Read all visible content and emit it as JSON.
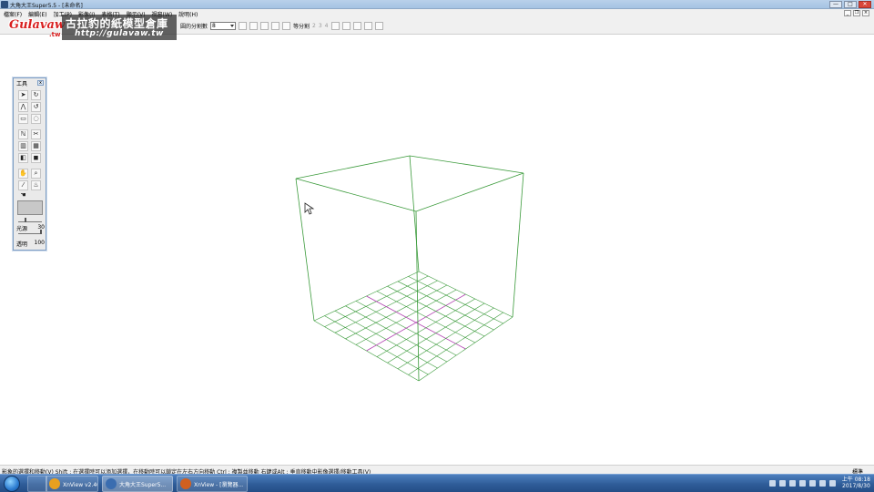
{
  "window": {
    "title": "大角大王Super5.5 - [未命名]",
    "controls": [
      "—",
      "□",
      "✕"
    ]
  },
  "menu": {
    "items": [
      "檔案(F)",
      "編輯(E)",
      "加工(P)",
      "影像(I)",
      "表格(T)",
      "顯示(V)",
      "視窗(W)",
      "說明(H)"
    ],
    "mdi_controls": [
      "_",
      "❐",
      "×"
    ]
  },
  "toolbar": {
    "split_label": "圓的分割數",
    "split_value": "8",
    "split2_label": "等分割",
    "split2_values": [
      "2",
      "3",
      "4"
    ]
  },
  "watermark": {
    "logo": "Gulavaw",
    "logo_sub": ".tw",
    "site_name": "古拉豹的紙模型倉庫",
    "url": "http://gulavaw.tw"
  },
  "tool_palette": {
    "title": "工具",
    "close": "x",
    "light_label": "光源",
    "light_value": "30",
    "light_level": 0.3,
    "alpha_label": "透明",
    "alpha_value": "100",
    "alpha_level": 1.0,
    "swatch_color": "#c8c8c8"
  },
  "scene": {
    "wire_color": "#3a9a3a",
    "axis_color": "#b040b0",
    "grid_divisions": 10
  },
  "status": {
    "hint": "影象的選擇和移動(V)   Shift : 在選擇時可以添加選擇，在移動時可以鎖定在左右方向移動   Ctrl : 複製並移動   右鍵或Alt : 垂直移動中影像選擇/移動工具(V)",
    "mode": "標準"
  },
  "taskbar": {
    "tasks": [
      {
        "label": "XnView v2.40 免...",
        "color": "#e8a020"
      },
      {
        "label": "大角大王Super5...",
        "color": "#3a6db0"
      },
      {
        "label": "XnView - [瀏覽器...",
        "color": "#d06020"
      }
    ],
    "time": "上午 08:18",
    "date": "2017/8/30"
  }
}
